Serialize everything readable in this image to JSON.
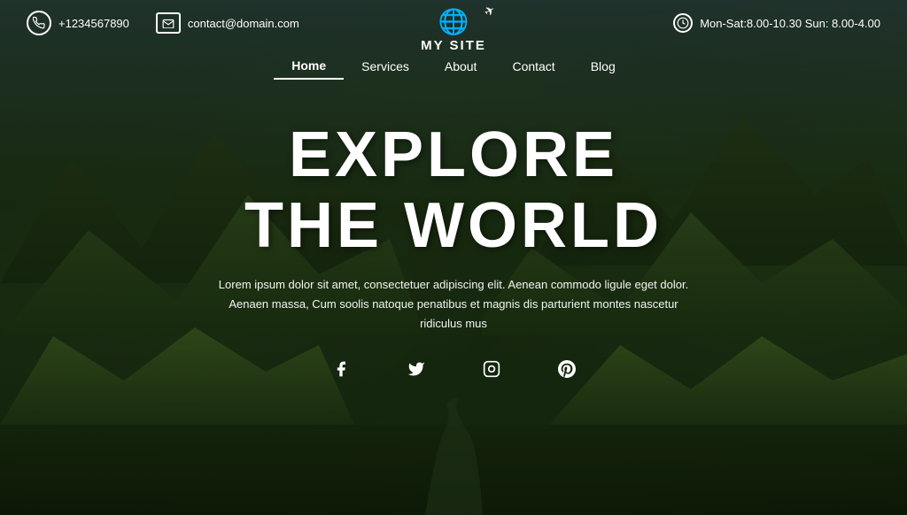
{
  "topbar": {
    "phone": "+1234567890",
    "email": "contact@domain.com",
    "hours": "Mon-Sat:8.00-10.30 Sun: 8.00-4.00"
  },
  "logo": {
    "text": "MY SITE"
  },
  "nav": {
    "items": [
      {
        "label": "Home",
        "active": true
      },
      {
        "label": "Services",
        "active": false
      },
      {
        "label": "About",
        "active": false
      },
      {
        "label": "Contact",
        "active": false
      },
      {
        "label": "Blog",
        "active": false
      }
    ]
  },
  "hero": {
    "title1": "EXPLORE",
    "title2": "THE WORLD",
    "subtitle": "Lorem ipsum dolor sit amet, consectetuer adipiscing elit. Aenean commodo ligule eget dolor. Aenaen massa, Cum soolis natoque penatibus et magnis dis parturient montes nascetur ridiculus mus"
  },
  "social": {
    "items": [
      {
        "icon": "f",
        "label": "facebook"
      },
      {
        "icon": "𝕏",
        "label": "twitter"
      },
      {
        "icon": "⬡",
        "label": "instagram"
      },
      {
        "icon": "𝒫",
        "label": "pinterest"
      }
    ]
  },
  "colors": {
    "accent": "#ffffff",
    "nav_active_border": "#ffffff"
  }
}
